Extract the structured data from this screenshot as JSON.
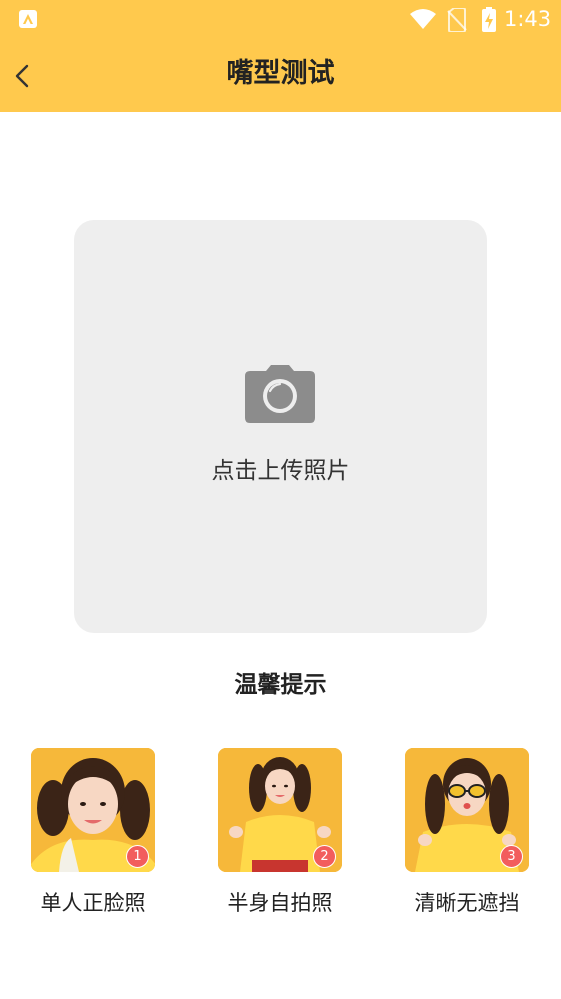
{
  "status_bar": {
    "time": "1:43",
    "icons": [
      "app-notification-icon",
      "wifi-icon",
      "no-sim-icon",
      "battery-charging-icon"
    ]
  },
  "header": {
    "title": "嘴型测试",
    "back_icon": "back-arrow-icon",
    "background_color": "#FFC94D"
  },
  "upload": {
    "label": "点击上传照片",
    "icon": "camera-icon"
  },
  "tips": {
    "title": "温馨提示",
    "items": [
      {
        "label": "单人正脸照",
        "badge": "1"
      },
      {
        "label": "半身自拍照",
        "badge": "2"
      },
      {
        "label": "清晰无遮挡",
        "badge": "3"
      }
    ]
  },
  "colors": {
    "accent": "#FFC94D",
    "badge": "#F25D5D",
    "card": "#EEEEEE"
  }
}
